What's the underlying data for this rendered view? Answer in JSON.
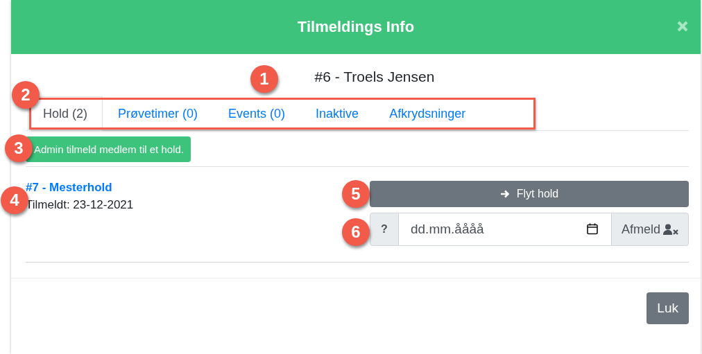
{
  "dialog": {
    "title": "Tilmeldings Info"
  },
  "member_heading": "#6 - Troels Jensen",
  "tabs": [
    {
      "label": "Hold (2)",
      "selected": true
    },
    {
      "label": "Prøvetimer (0)",
      "selected": false
    },
    {
      "label": "Events (0)",
      "selected": false
    },
    {
      "label": "Inaktive",
      "selected": false
    },
    {
      "label": "Afkrydsninger",
      "selected": false
    }
  ],
  "admin_button": "Admin tilmeld medlem til et hold.",
  "enrollments": [
    {
      "team": "#7 - Mesterhold",
      "enrolled": "Tilmeldt: 23-12-2021",
      "move_button": "Flyt hold",
      "help": "?",
      "date_placeholder": "dd.mm.åååå",
      "unenroll_button": "Afmeld"
    }
  ],
  "footer": {
    "close_button": "Luk"
  },
  "annotations": [
    {
      "number": "1"
    },
    {
      "number": "2"
    },
    {
      "number": "3"
    },
    {
      "number": "4"
    },
    {
      "number": "5"
    },
    {
      "number": "6"
    }
  ]
}
